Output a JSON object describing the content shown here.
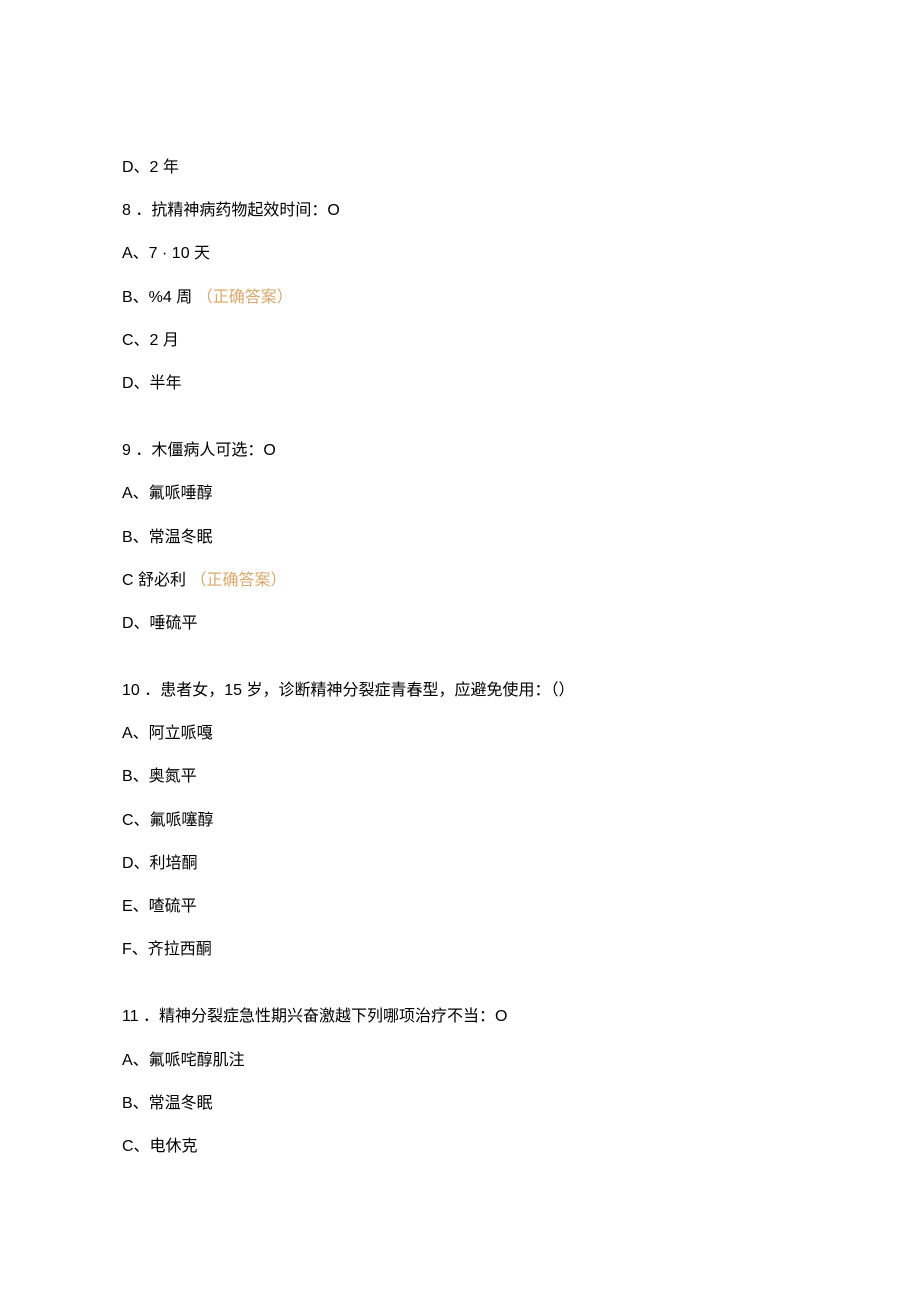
{
  "answer_label": "（正确答案）",
  "q7_options": {
    "d": "D、2 年"
  },
  "q8": {
    "stem": "8 ．抗精神病药物起效时间：O",
    "a": "A、7 · 10 天",
    "b_text": "B、%4 周",
    "c": "C、2 月",
    "d": "D、半年"
  },
  "q9": {
    "stem": "9 ．木僵病人可选：O",
    "a": "A、氟哌唾醇",
    "b": "B、常温冬眠",
    "c_text": "C 舒必利",
    "d": "D、唾硫平"
  },
  "q10": {
    "stem": "10 ．患者女，15 岁，诊断精神分裂症青春型，应避免使用：（）",
    "a": "A、阿立哌嘎",
    "b": "B、奥氮平",
    "c": "C、氟哌噻醇",
    "d": "D、利培酮",
    "e": "E、喳硫平",
    "f": "F、齐拉西酮"
  },
  "q11": {
    "stem": "11 ．精神分裂症急性期兴奋激越下列哪项治疗不当：O",
    "a": "A、氟哌咤醇肌注",
    "b": "B、常温冬眠",
    "c": "C、电休克"
  }
}
